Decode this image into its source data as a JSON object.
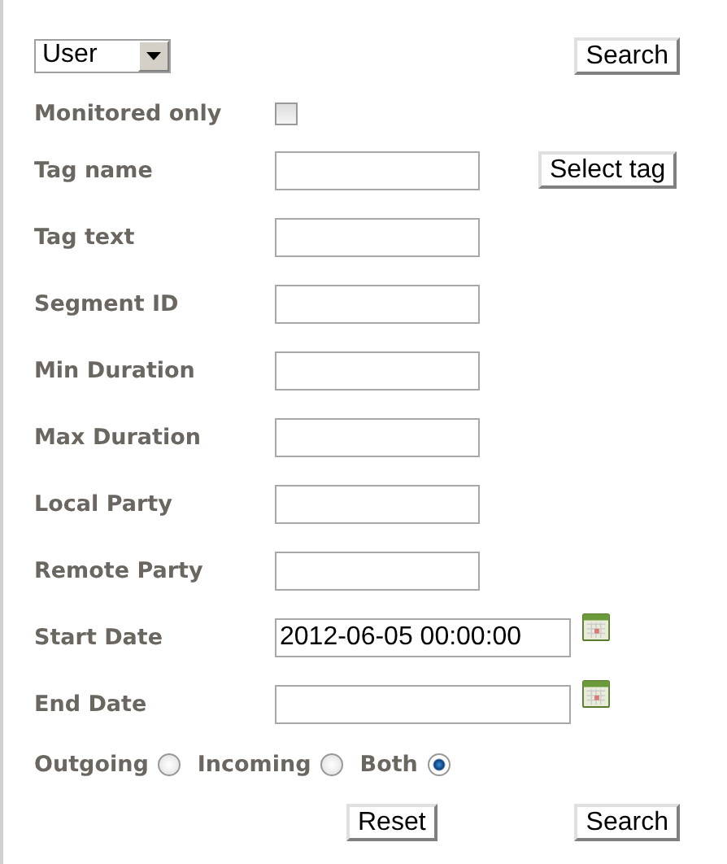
{
  "type_select": {
    "value": "User"
  },
  "top_button": "Search",
  "monitored": {
    "label": "Monitored only",
    "checked": false
  },
  "fields": [
    {
      "label": "Tag name",
      "kind": "button",
      "button": "Select tag"
    },
    {
      "label": "Tag text",
      "kind": "text"
    },
    {
      "label": "Segment ID",
      "kind": "text"
    },
    {
      "label": "Min Duration",
      "kind": "text"
    },
    {
      "label": "Max Duration",
      "kind": "text"
    },
    {
      "label": "Local Party",
      "kind": "text"
    },
    {
      "label": "Remote Party",
      "kind": "text"
    },
    {
      "label": "Start Date",
      "kind": "date",
      "value": "2012-06-05 00:00:00"
    },
    {
      "label": "End Date",
      "kind": "date"
    }
  ],
  "direction": [
    {
      "label": "Outgoing",
      "selected": false
    },
    {
      "label": "Incoming",
      "selected": false
    },
    {
      "label": "Both",
      "selected": true
    }
  ],
  "buttons": [
    "Reset",
    "Search"
  ]
}
